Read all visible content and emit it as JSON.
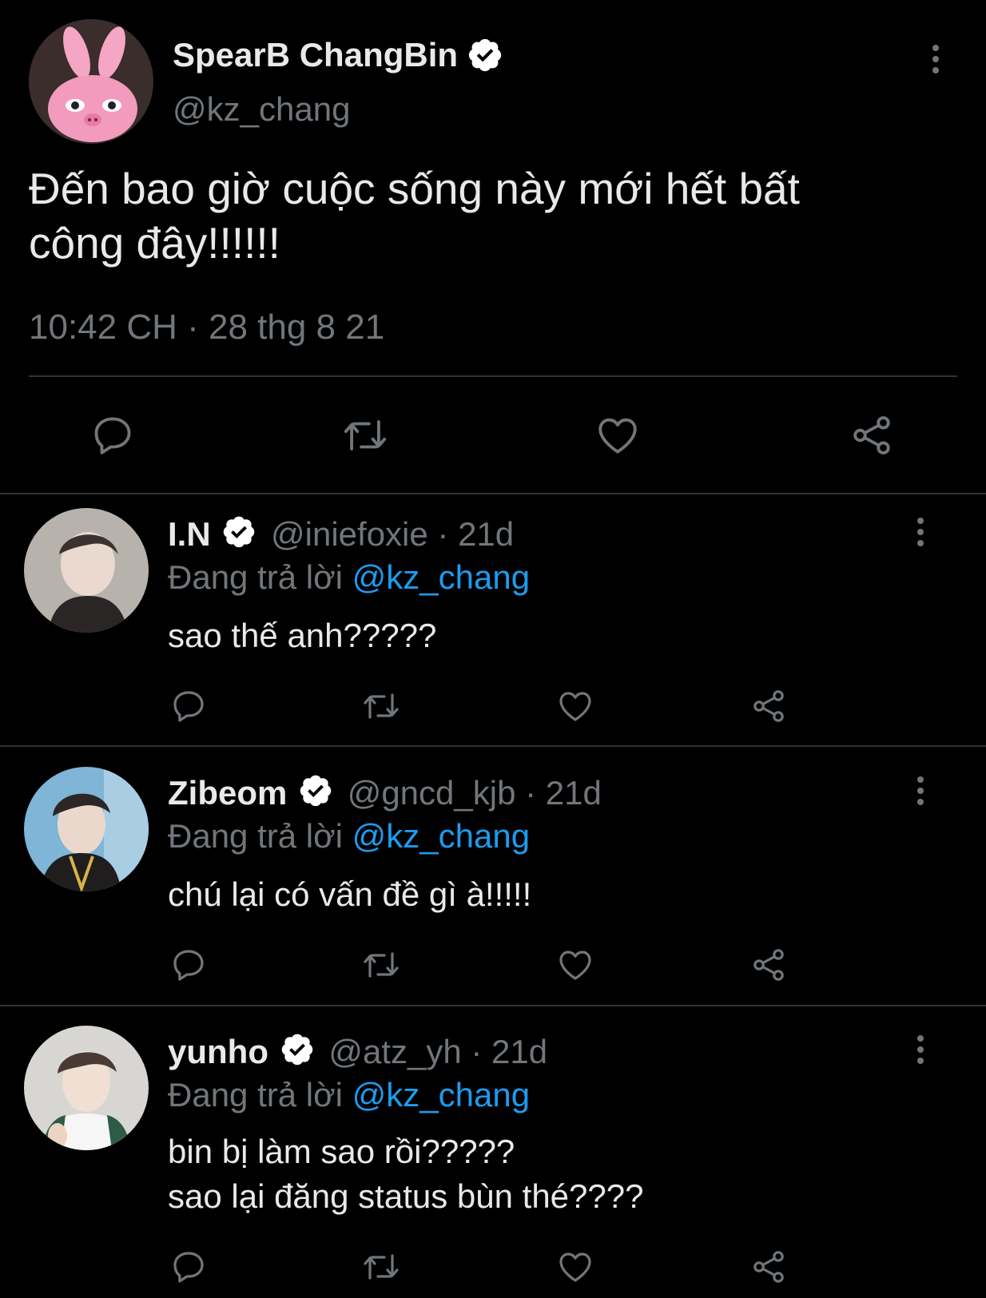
{
  "colors": {
    "background": "#000000",
    "text": "#e7e9ea",
    "muted": "#71767b",
    "link": "#1d9bf0",
    "divider": "#2f3336"
  },
  "main_tweet": {
    "display_name": "SpearB ChangBin",
    "handle": "@kz_chang",
    "verified_icon": "verified-badge-icon",
    "text_line1": "Đến bao giờ cuộc sống này mới hết bất",
    "text_line2": "công đây!!!!!!",
    "timestamp": "10:42 CH · 28 thg 8 21",
    "actions": [
      "reply-icon",
      "retweet-icon",
      "like-icon",
      "share-icon"
    ]
  },
  "replies": [
    {
      "display_name": "I.N",
      "handle_time": "@iniefoxie · 21d",
      "replying_prefix": "Đang trả lời",
      "replying_to": "@kz_chang",
      "text_lines": [
        "sao thế anh?????"
      ]
    },
    {
      "display_name": "Zibeom",
      "handle_time": "@gncd_kjb · 21d",
      "replying_prefix": "Đang trả lời",
      "replying_to": "@kz_chang",
      "text_lines": [
        "chú lại có vấn đề gì à!!!!!"
      ]
    },
    {
      "display_name": "yunho",
      "handle_time": "@atz_yh · 21d",
      "replying_prefix": "Đang trả lời",
      "replying_to": "@kz_chang",
      "text_lines": [
        "bin bị làm sao rồi?????",
        "sao lại đăng status bùn thé????"
      ]
    }
  ]
}
